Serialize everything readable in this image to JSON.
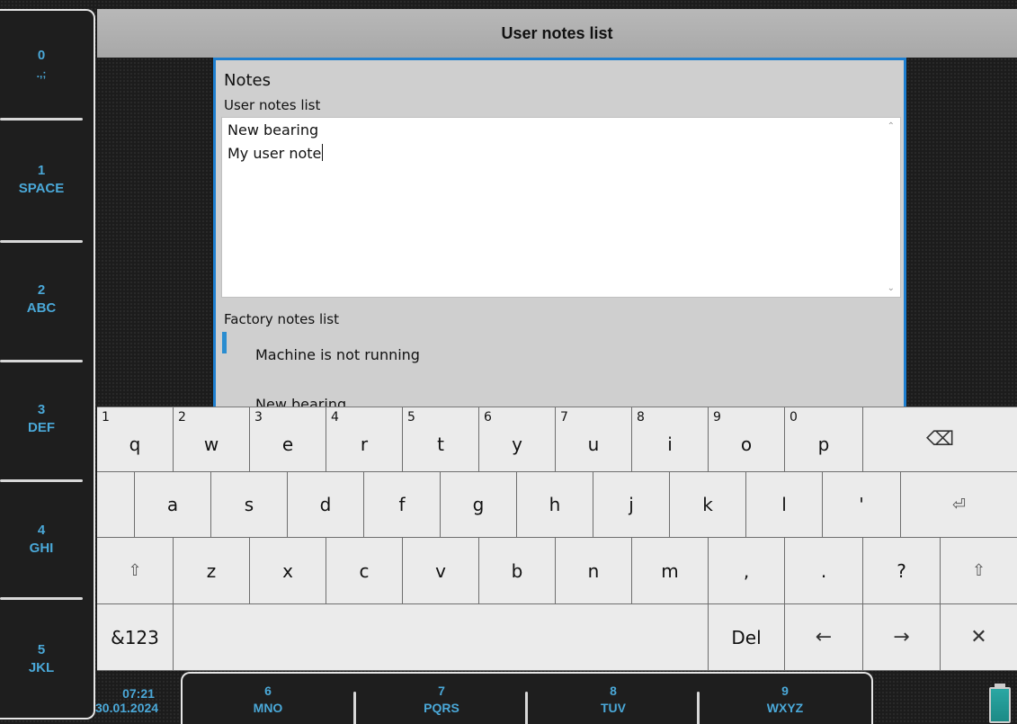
{
  "header": {
    "title": "User notes list"
  },
  "left_keys": [
    {
      "num": "0",
      "label": ".,;"
    },
    {
      "num": "1",
      "label": "SPACE"
    },
    {
      "num": "2",
      "label": "ABC"
    },
    {
      "num": "3",
      "label": "DEF"
    },
    {
      "num": "4",
      "label": "GHI"
    },
    {
      "num": "5",
      "label": "JKL"
    }
  ],
  "bottom_keys": [
    {
      "num": "6",
      "label": "MNO"
    },
    {
      "num": "7",
      "label": "PQRS"
    },
    {
      "num": "8",
      "label": "TUV"
    },
    {
      "num": "9",
      "label": "WXYZ"
    }
  ],
  "status": {
    "time": "07:21",
    "date": "30.01.2024"
  },
  "panel": {
    "title": "Notes",
    "user_label": "User notes list",
    "user_notes": [
      "New bearing",
      "My user note"
    ],
    "factory_label": "Factory notes list",
    "factory_notes": [
      "Machine is not running",
      "New bearing"
    ]
  },
  "keyboard": {
    "row1": [
      {
        "num": "1",
        "ch": "q"
      },
      {
        "num": "2",
        "ch": "w"
      },
      {
        "num": "3",
        "ch": "e"
      },
      {
        "num": "4",
        "ch": "r"
      },
      {
        "num": "5",
        "ch": "t"
      },
      {
        "num": "6",
        "ch": "y"
      },
      {
        "num": "7",
        "ch": "u"
      },
      {
        "num": "8",
        "ch": "i"
      },
      {
        "num": "9",
        "ch": "o"
      },
      {
        "num": "0",
        "ch": "p"
      }
    ],
    "row2": [
      "a",
      "s",
      "d",
      "f",
      "g",
      "h",
      "j",
      "k",
      "l",
      "'"
    ],
    "row3": [
      "z",
      "x",
      "c",
      "v",
      "b",
      "n",
      "m",
      ",",
      ".",
      "?"
    ],
    "backspace": "⌫",
    "enter": "⏎",
    "shift": "⇧",
    "numbers_label": "&123",
    "del_label": "Del",
    "left_arrow": "←",
    "right_arrow": "→",
    "close": "✕"
  },
  "colors": {
    "accent": "#4aa8d8",
    "panel_border": "#1e7fd0",
    "battery": "#2aa7a3"
  }
}
